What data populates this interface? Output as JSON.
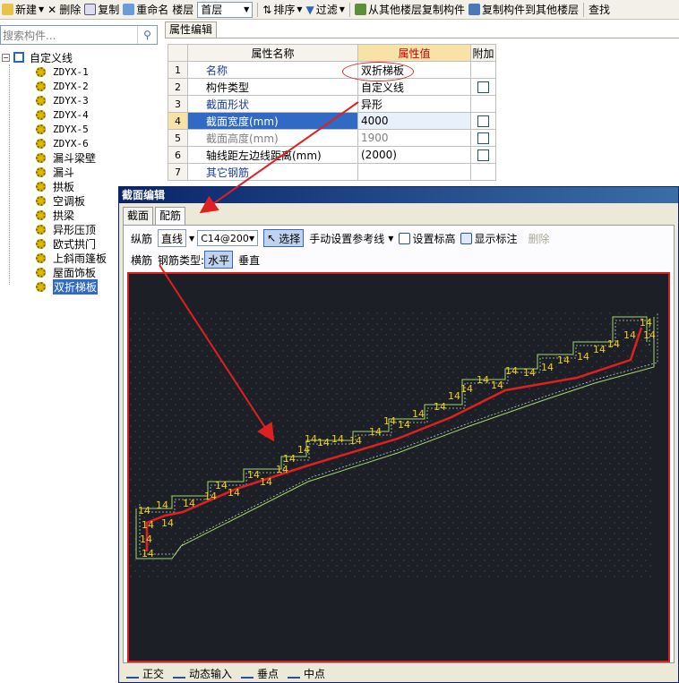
{
  "toolbar": {
    "new": "新建",
    "delete": "删除",
    "copy": "复制",
    "rename": "重命名",
    "floor_label": "楼层",
    "floor_value": "首层",
    "sort": "排序",
    "filter": "过滤",
    "copy_from_floor": "从其他楼层复制构件",
    "copy_to_floor": "复制构件到其他楼层",
    "find": "查找"
  },
  "search": {
    "placeholder": "搜索构件..."
  },
  "tree": {
    "root": "自定义线",
    "items": [
      "ZDYX-1",
      "ZDYX-2",
      "ZDYX-3",
      "ZDYX-4",
      "ZDYX-5",
      "ZDYX-6",
      "漏斗梁壁",
      "漏斗",
      "拱板",
      "空调板",
      "拱梁",
      "异形压顶",
      "欧式拱门",
      "上斜雨篷板",
      "屋面饰板",
      "双折梯板"
    ]
  },
  "properties": {
    "tab": "属性编辑",
    "headers": {
      "name": "属性名称",
      "value": "属性值",
      "extra": "附加"
    },
    "rows": [
      {
        "idx": "1",
        "name": "名称",
        "value": "双折梯板"
      },
      {
        "idx": "2",
        "name": "构件类型",
        "value": "自定义线"
      },
      {
        "idx": "3",
        "name": "截面形状",
        "value": "异形"
      },
      {
        "idx": "4",
        "name": "截面宽度(mm)",
        "value": "4000"
      },
      {
        "idx": "5",
        "name": "截面高度(mm)",
        "value": "1900"
      },
      {
        "idx": "6",
        "name": "轴线距左边线距离(mm)",
        "value": "(2000)"
      },
      {
        "idx": "7",
        "name": "其它钢筋",
        "value": ""
      }
    ]
  },
  "dialog": {
    "title": "截面编辑",
    "tabs": [
      "截面",
      "配筋"
    ],
    "row1": {
      "longitudinal": "纵筋",
      "mode": "直线",
      "spec": "C14@200",
      "select": "选择",
      "manual_ref": "手动设置参考线",
      "set_elev": "设置标高",
      "show_label": "显示标注",
      "delete": "删除"
    },
    "row2": {
      "transverse": "横筋",
      "bar_type_label": "钢筋类型:",
      "horizontal": "水平",
      "vertical": "垂直"
    },
    "canvas_label": "14",
    "status": {
      "ortho": "正交",
      "dynamic": "动态输入",
      "perp": "垂点",
      "mid": "中点"
    }
  },
  "colors": {
    "accent_red": "#d81e1e",
    "selection_blue": "#316ac5",
    "canvas_bg": "#1c2026",
    "rebar_red": "#e02020",
    "rebar_label": "#f5d000",
    "outline_green": "#9fd86a"
  }
}
